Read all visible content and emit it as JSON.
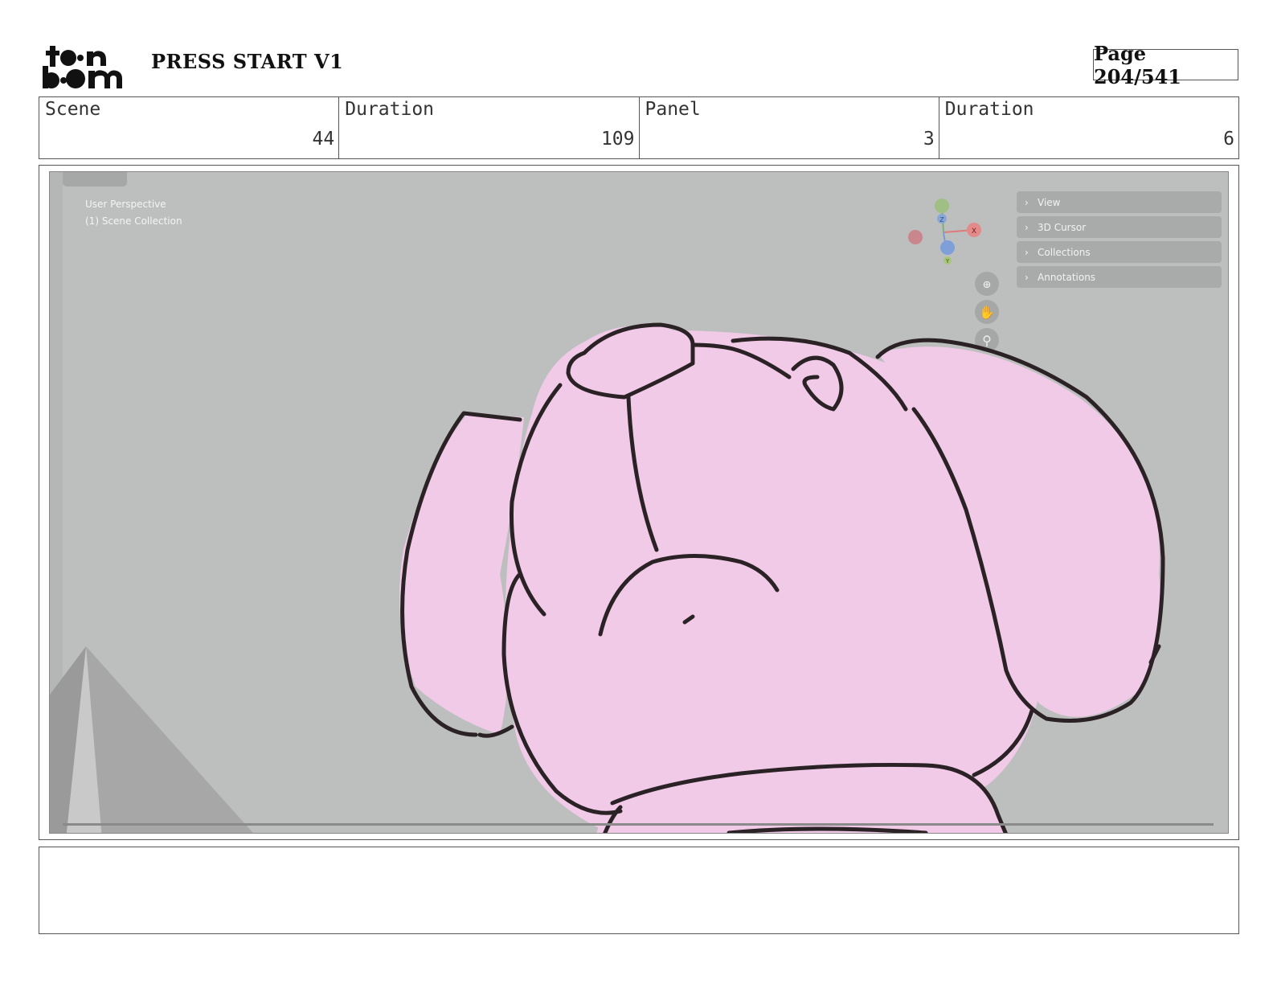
{
  "header": {
    "logo_alt": "toon boom",
    "project_title": "PRESS START V1",
    "page_label": "Page 204/541"
  },
  "info": {
    "scene_label": "Scene",
    "scene_value": "44",
    "scene_duration_label": "Duration",
    "scene_duration_value": "109",
    "panel_label": "Panel",
    "panel_value": "3",
    "panel_duration_label": "Duration",
    "panel_duration_value": "6"
  },
  "viewport": {
    "perspective_label": "User Perspective",
    "collection_label": "(1) Scene Collection",
    "n_panel": [
      "View",
      "3D Cursor",
      "Collections",
      "Annotations"
    ],
    "gizmo_axes": {
      "x": "X",
      "y": "Y",
      "z": "Z"
    }
  },
  "colors": {
    "viewport_bg": "#bdbfbe",
    "character_fill": "#f1cae8",
    "line_color": "#2b2226"
  },
  "notes": {
    "text": ""
  }
}
